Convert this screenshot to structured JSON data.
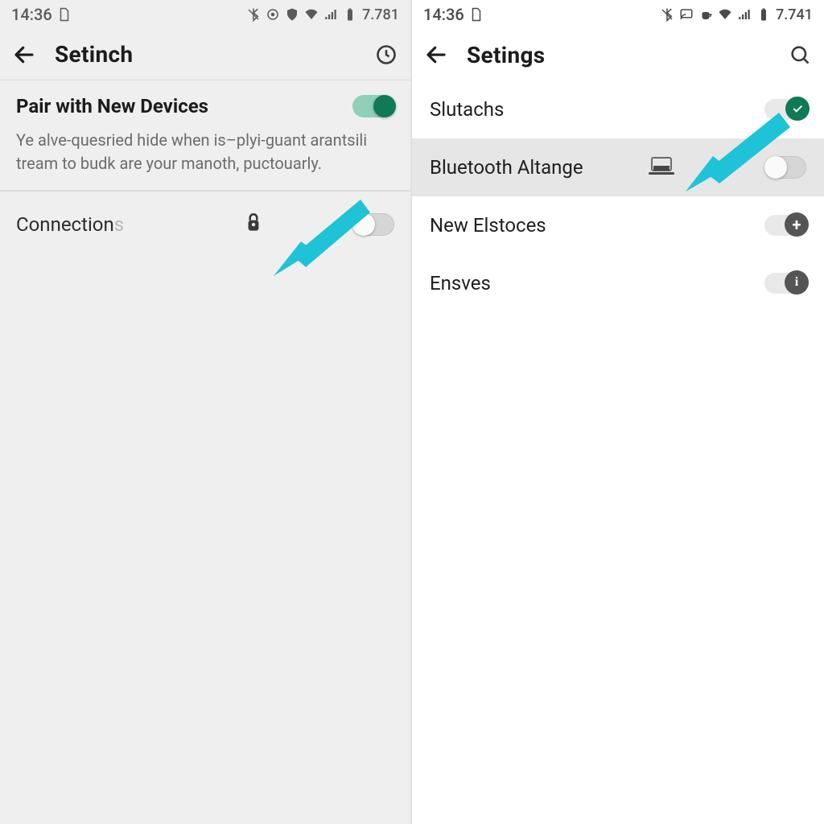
{
  "leftPhone": {
    "statusbar": {
      "time": "14:36",
      "right_text": "7.781"
    },
    "toolbar": {
      "title": "Setinch"
    },
    "pair_row": {
      "title": "Pair with New Devices",
      "desc": "Ye alve-quesried hide when is–plyi-guant arantsili tream to budk are your manoth, puctouarly.",
      "toggle_on": true
    },
    "conn_row": {
      "label_main": "Connection",
      "label_faded": "s",
      "toggle_on": false
    }
  },
  "rightPhone": {
    "statusbar": {
      "time": "14:36",
      "right_text": "7.741"
    },
    "toolbar": {
      "title": "Setings"
    },
    "rows": [
      {
        "label": "Slutachs",
        "control": "check"
      },
      {
        "label": "Bluetooth Altange",
        "control": "switch_off",
        "highlight": true,
        "has_laptop_icon": true
      },
      {
        "label": "New Elstoces",
        "control": "plus"
      },
      {
        "label": "Ensves",
        "control": "info"
      }
    ]
  }
}
